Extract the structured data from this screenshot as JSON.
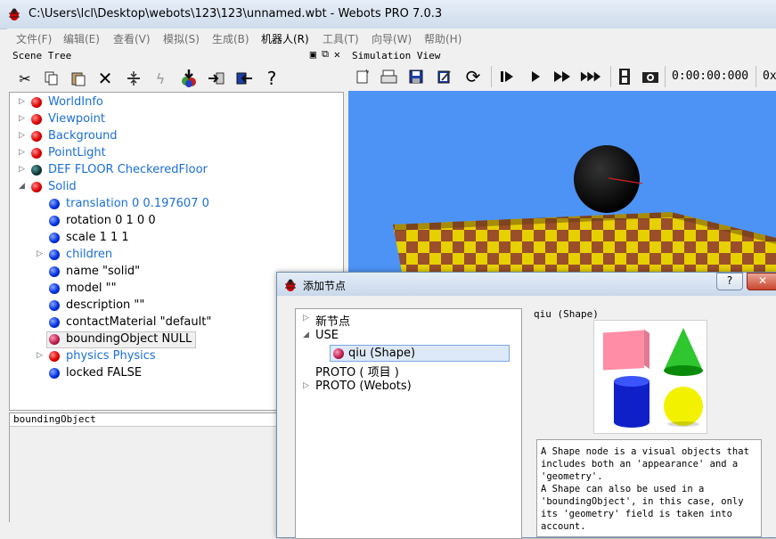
{
  "window": {
    "title": "C:\\Users\\lcl\\Desktop\\webots\\123\\123\\unnamed.wbt - Webots PRO 7.0.3"
  },
  "menu": [
    "文件(F)",
    "编辑(E)",
    "查看(V)",
    "模拟(S)",
    "生成(B)",
    "机器人(R)",
    "工具(T)",
    "向导(W)",
    "帮助(H)"
  ],
  "scene_tree": {
    "title": "Scene Tree",
    "toolbar_icons": [
      "cut-icon",
      "copy-icon",
      "paste-icon",
      "delete-icon",
      "reset-to-default-icon",
      "transform-icon",
      "add-node-icon",
      "export-icon",
      "import-icon",
      "help-icon"
    ],
    "help_glyph": "?",
    "nodes": [
      {
        "label": "WorldInfo",
        "color": "red",
        "depth": 0,
        "expandable": true,
        "link": true
      },
      {
        "label": "Viewpoint",
        "color": "red",
        "depth": 0,
        "expandable": true,
        "link": true
      },
      {
        "label": "Background",
        "color": "red",
        "depth": 0,
        "expandable": true,
        "link": true
      },
      {
        "label": "PointLight",
        "color": "red",
        "depth": 0,
        "expandable": true,
        "link": true
      },
      {
        "label": "DEF FLOOR CheckeredFloor",
        "color": "dark",
        "depth": 0,
        "expandable": true,
        "link": true
      },
      {
        "label": "Solid",
        "color": "red",
        "depth": 0,
        "expandable": true,
        "expanded": true,
        "link": true
      },
      {
        "label": "translation 0 0.197607 0",
        "color": "blue",
        "depth": 1,
        "expandable": false,
        "link": true
      },
      {
        "label": "rotation 0 1 0 0",
        "color": "blue",
        "depth": 1,
        "expandable": false,
        "link": false
      },
      {
        "label": "scale 1 1 1",
        "color": "blue",
        "depth": 1,
        "expandable": false,
        "link": false
      },
      {
        "label": "children",
        "color": "blue",
        "depth": 1,
        "expandable": true,
        "link": true
      },
      {
        "label": "name \"solid\"",
        "color": "blue",
        "depth": 1,
        "expandable": false,
        "link": false
      },
      {
        "label": "model \"\"",
        "color": "blue",
        "depth": 1,
        "expandable": false,
        "link": false
      },
      {
        "label": "description \"\"",
        "color": "blue",
        "depth": 1,
        "expandable": false,
        "link": false
      },
      {
        "label": "contactMaterial \"default\"",
        "color": "blue",
        "depth": 1,
        "expandable": false,
        "link": false
      },
      {
        "label": "boundingObject NULL",
        "color": "maroon",
        "depth": 1,
        "expandable": false,
        "link": false,
        "selected": true
      },
      {
        "label": "physics Physics",
        "color": "red",
        "depth": 1,
        "expandable": true,
        "link": true
      },
      {
        "label": "locked FALSE",
        "color": "blue",
        "depth": 1,
        "expandable": false,
        "link": false
      }
    ],
    "field_panel_label": "boundingObject"
  },
  "simulation_view": {
    "title": "Simulation View",
    "toolbar_icons": [
      "new-world-icon",
      "open-world-icon",
      "save-world-icon",
      "edit-icon",
      "reload-icon",
      "step-icon",
      "run-icon",
      "fast-icon",
      "fastest-icon",
      "movie-icon",
      "screenshot-icon"
    ],
    "time": "0:00:00:000",
    "speed": "0x"
  },
  "add_node_dialog": {
    "title": "添加节点",
    "help_button": "?",
    "tree": [
      {
        "label": "新节点",
        "depth": 0,
        "expandable": true,
        "expanded": false
      },
      {
        "label": "USE",
        "depth": 0,
        "expandable": true,
        "expanded": true
      },
      {
        "label": "qiu (Shape)",
        "depth": 1,
        "expandable": false,
        "selected": true
      },
      {
        "label": "PROTO ( 项目 )",
        "depth": 0,
        "expandable": false
      },
      {
        "label": "PROTO (Webots)",
        "depth": 0,
        "expandable": true,
        "expanded": false
      }
    ],
    "preview_label": "qiu (Shape)",
    "description": "A Shape node is a visual objects that includes both an 'appearance' and a 'geometry'.\nA Shape can also be used in a 'boundingObject', in this case, only its 'geometry' field is taken into account."
  },
  "colors": {
    "sky": "#4d93f5",
    "checker_a": "#e6d000",
    "checker_b": "#9a4e2a",
    "link": "#1a6ed8"
  }
}
